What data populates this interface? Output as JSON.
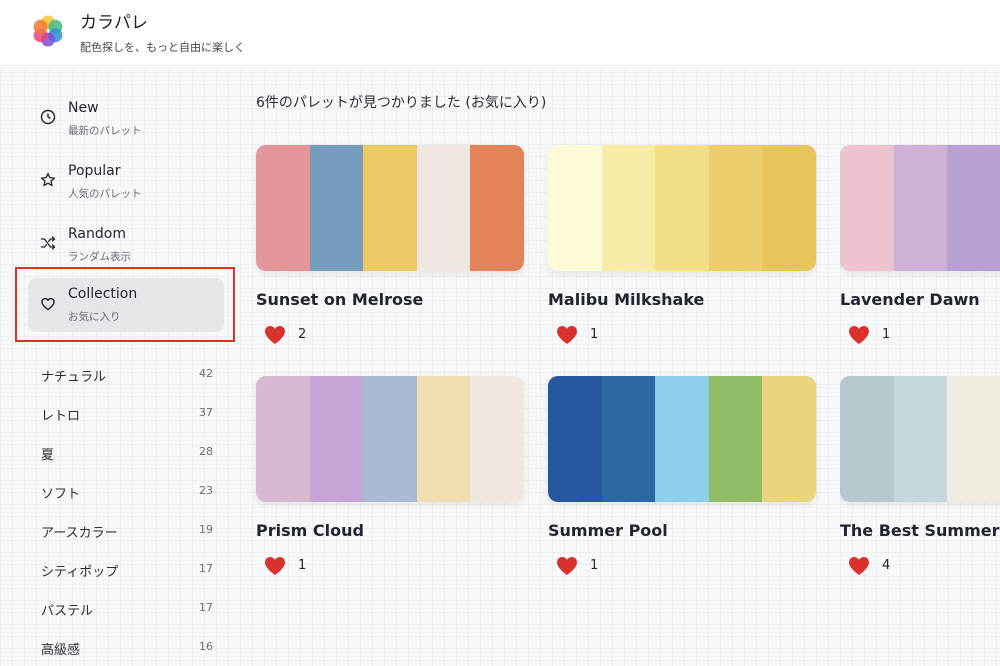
{
  "header": {
    "app_title": "カラパレ",
    "app_subtitle": "配色探しを、もっと自由に楽しく"
  },
  "sidebar": {
    "nav": [
      {
        "label": "New",
        "sub": "最新のパレット",
        "icon": "clock-icon",
        "active": false
      },
      {
        "label": "Popular",
        "sub": "人気のパレット",
        "icon": "star-icon",
        "active": false
      },
      {
        "label": "Random",
        "sub": "ランダム表示",
        "icon": "shuffle-icon",
        "active": false
      },
      {
        "label": "Collection",
        "sub": "お気に入り",
        "icon": "heart-outline-icon",
        "active": true
      }
    ],
    "categories": [
      {
        "name": "ナチュラル",
        "count": "42"
      },
      {
        "name": "レトロ",
        "count": "37"
      },
      {
        "name": "夏",
        "count": "28"
      },
      {
        "name": "ソフト",
        "count": "23"
      },
      {
        "name": "アースカラー",
        "count": "19"
      },
      {
        "name": "シティポップ",
        "count": "17"
      },
      {
        "name": "パステル",
        "count": "17"
      },
      {
        "name": "高級感",
        "count": "16"
      }
    ]
  },
  "main": {
    "result_text": "6件のパレットが見つかりました (お気に入り)",
    "palettes": [
      {
        "name": "Sunset on Melrose",
        "likes": "2",
        "colors": [
          "#e4959a",
          "#769dbd",
          "#ebc963",
          "#f0e5e0",
          "#e48259"
        ]
      },
      {
        "name": "Malibu Milkshake",
        "likes": "1",
        "colors": [
          "#fdfad8",
          "#f6eba7",
          "#f1de87",
          "#ecce6f",
          "#e8c45c"
        ]
      },
      {
        "name": "Lavender Dawn",
        "likes": "1",
        "colors": [
          "#ecc3ce",
          "#cdb1d6",
          "#b9a0d3",
          "#b2a3d8",
          "#ae9fd4"
        ]
      },
      {
        "name": "Prism Cloud",
        "likes": "1",
        "colors": [
          "#d8b8d1",
          "#c7a4d6",
          "#a9bad5",
          "#f0ddb0",
          "#f1e7e1"
        ]
      },
      {
        "name": "Summer Pool",
        "likes": "1",
        "colors": [
          "#26589f",
          "#2d68a3",
          "#8ecdec",
          "#92bd68",
          "#ecd37d"
        ]
      },
      {
        "name": "The Best Summer",
        "likes": "4",
        "colors": [
          "#b6c7cd",
          "#c4d7db",
          "#f0ede0",
          "#e9d6a8",
          "#d9b77c"
        ]
      }
    ]
  },
  "colors": {
    "heart": "#d9312c",
    "active_nav_bg": "#e5e6ea",
    "highlight_border": "#e0321f"
  }
}
